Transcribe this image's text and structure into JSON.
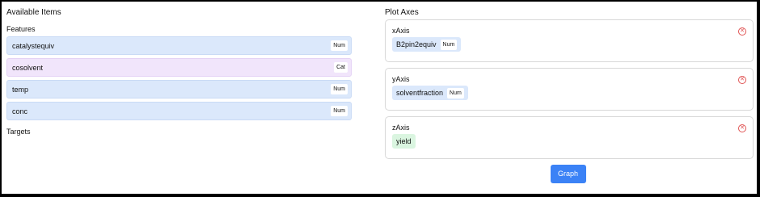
{
  "left_panel": {
    "title": "Available Items",
    "features_heading": "Features",
    "features": [
      {
        "label": "catalystequiv",
        "type": "Num"
      },
      {
        "label": "cosolvent",
        "type": "Cat"
      },
      {
        "label": "temp",
        "type": "Num"
      },
      {
        "label": "conc",
        "type": "Num"
      }
    ],
    "targets_heading": "Targets"
  },
  "right_panel": {
    "title": "Plot Axes",
    "axes": [
      {
        "label": "xAxis",
        "item": "B2pin2equiv",
        "item_type": "Num"
      },
      {
        "label": "yAxis",
        "item": "solventfraction",
        "item_type": "Num"
      },
      {
        "label": "zAxis",
        "item": "yield"
      }
    ],
    "graph_button": "Graph"
  },
  "colors": {
    "numeric_item_bg": "#dbe8fb",
    "categorical_item_bg": "#f1e5fb",
    "target_item_bg": "#daf5e0",
    "remove_icon": "#e05353",
    "primary_button": "#3b82f6"
  }
}
